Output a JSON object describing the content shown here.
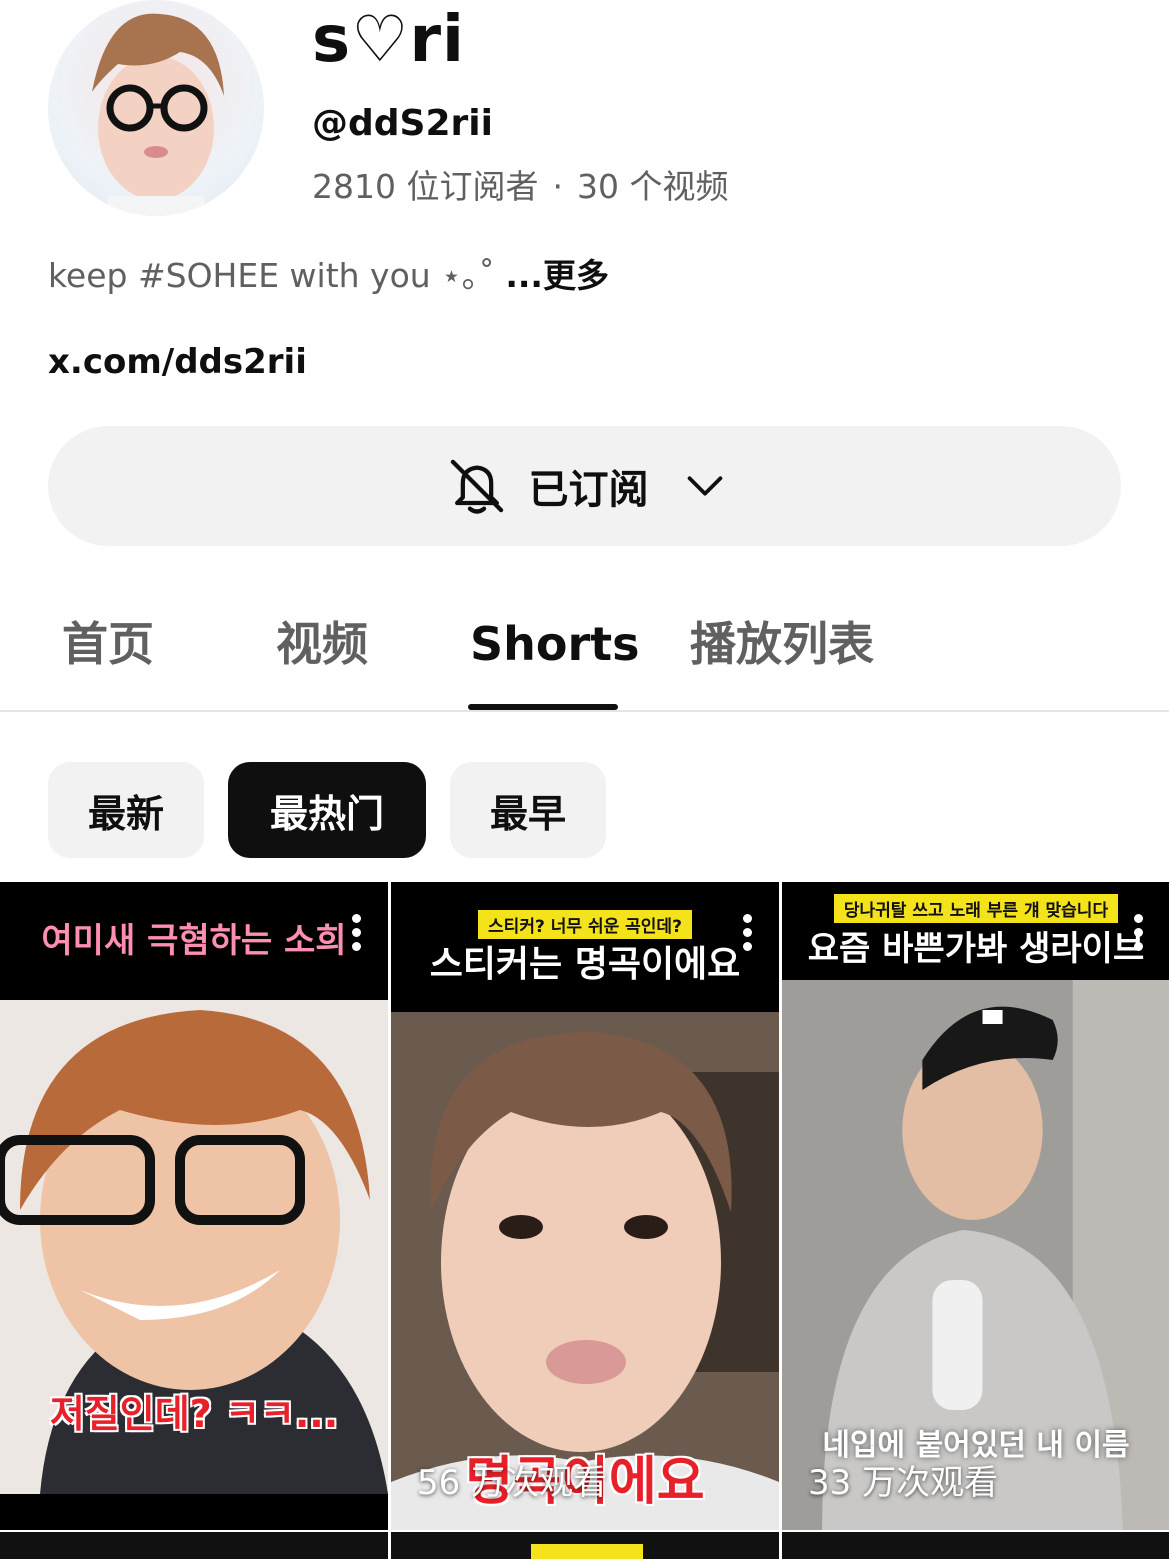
{
  "channel": {
    "name": "s♡ri",
    "handle": "@ddS2rii",
    "subscribers": "2810 位订阅者",
    "separator": "·",
    "video_count": "30 个视频",
    "description": "keep #SOHEE with you ⋆｡˚",
    "description_more": "...更多",
    "link": "x.com/dds2rii"
  },
  "subscribe_button": {
    "label": "已订阅",
    "icon": "bell-off-icon"
  },
  "tabs": [
    {
      "label": "首页",
      "active": false
    },
    {
      "label": "视频",
      "active": false
    },
    {
      "label": "Shorts",
      "active": true
    },
    {
      "label": "播放列表",
      "active": false
    }
  ],
  "chips": [
    {
      "label": "最新",
      "active": false
    },
    {
      "label": "最热门",
      "active": true
    },
    {
      "label": "最早",
      "active": false
    }
  ],
  "shorts": [
    {
      "title": "여미새 극혐하는 소희",
      "title_accent_color": "#ff8fb0",
      "caption": "저질인데? ㅋㅋ...",
      "caption_color": "#e8202a",
      "views": ""
    },
    {
      "subtitle": "스티커? 너무 쉬운 곡인데?",
      "title": "스티커는 명곡이에요",
      "title_accent_color": "#c8f04a",
      "caption": "명곡이에요",
      "caption_color": "#e8202a",
      "views": "56 万次观看"
    },
    {
      "subtitle": "당나귀탈 쓰고 노래 부른 걔 맞습니다",
      "title": "요즘 바쁜가봐 생라이브",
      "caption": "네입에 붙어있던 내 이름",
      "caption_color": "#ffffff",
      "views": "33 万次观看"
    }
  ]
}
